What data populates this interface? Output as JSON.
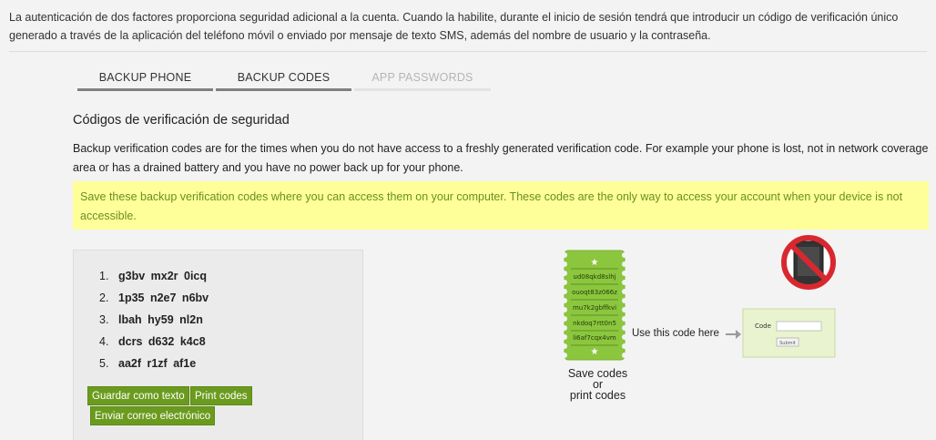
{
  "intro_text": "La autenticación de dos factores proporciona seguridad adicional a la cuenta. Cuando la habilite, durante el inicio de sesión tendrá que introducir un código de verificación único generado a través de la aplicación del teléfono móvil o enviado por mensaje de texto SMS, además del nombre de usuario y la contraseña.",
  "tabs": [
    {
      "label": "BACKUP PHONE",
      "state": "active"
    },
    {
      "label": "BACKUP CODES",
      "state": "active"
    },
    {
      "label": "APP PASSWORDS",
      "state": "inactive"
    }
  ],
  "section_title": "Códigos de verificación de seguridad",
  "description": "Backup verification codes are for the times when you do not have access to a freshly generated verification code. For example your phone is lost, not in network coverage area or has a drained battery and you have no power back up for your phone.",
  "notice": "Save these backup verification codes where you can access them on your computer. These codes are the only way to access your account when your device is not accessible.",
  "codes": [
    {
      "num": "1.",
      "code": "g3bv mx2r 0icq"
    },
    {
      "num": "2.",
      "code": "1p35 n2e7 n6bv"
    },
    {
      "num": "3.",
      "code": "lbah hy59 nl2n"
    },
    {
      "num": "4.",
      "code": "dcrs d632 k4c8"
    },
    {
      "num": "5.",
      "code": "aa2f r1zf af1e"
    }
  ],
  "buttons": {
    "save_text": "Guardar como texto",
    "print": "Print codes",
    "email": "Enviar correo electrónico"
  },
  "illustration": {
    "ticket_codes": [
      "ud08qkd8slhj",
      "ouoqt83z066z",
      "mu7k2gbffkvi",
      "nkdoq7rtt0n5",
      "li6af7cqx4vm"
    ],
    "ticket_caption": [
      "Save codes",
      "or",
      "print codes"
    ],
    "use_label": "Use this code here",
    "form_code_label": "Code",
    "form_button_label": "Submit"
  },
  "colors": {
    "background": "#f3f3f3",
    "notice_bg": "#ffff99",
    "notice_text": "#6b8e23",
    "button_green": "#6b9b1e",
    "ticket_green": "#8cc63f"
  }
}
